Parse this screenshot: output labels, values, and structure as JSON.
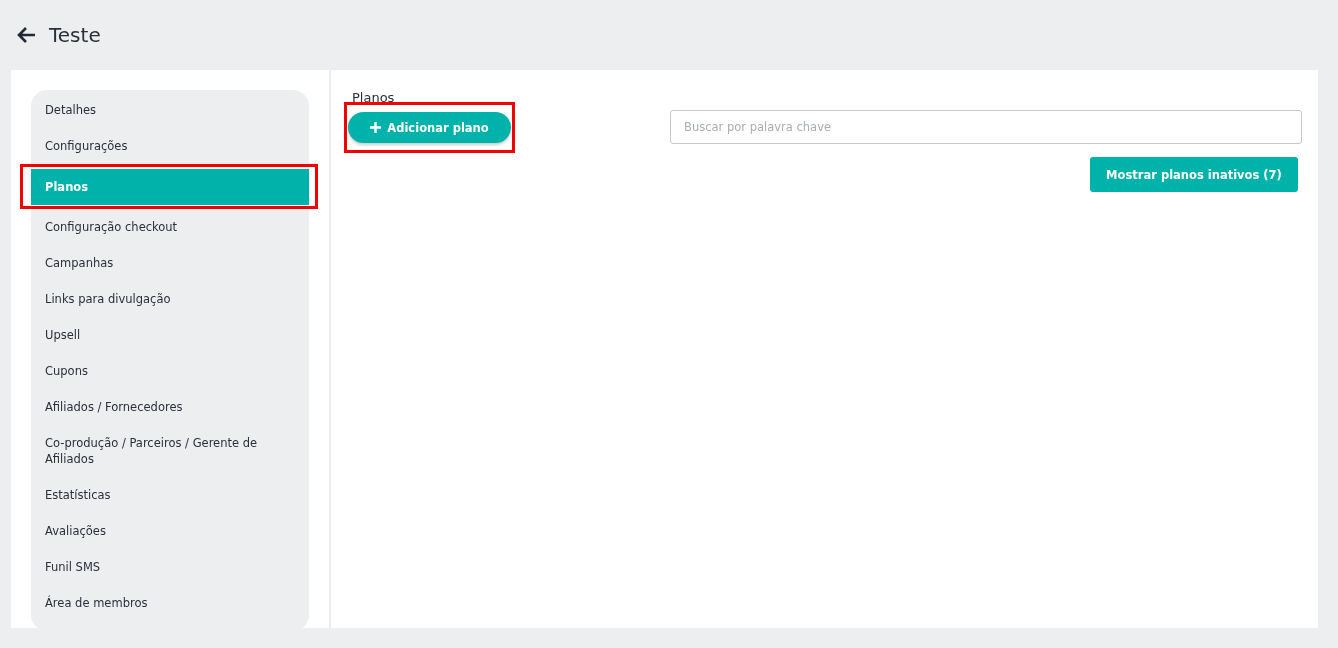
{
  "header": {
    "title": "Teste"
  },
  "sidebar": {
    "items": [
      {
        "label": "Detalhes",
        "selected": false,
        "highlighted": false
      },
      {
        "label": "Configurações",
        "selected": false,
        "highlighted": false
      },
      {
        "label": "Planos",
        "selected": true,
        "highlighted": true
      },
      {
        "label": "Configuração checkout",
        "selected": false,
        "highlighted": false
      },
      {
        "label": "Campanhas",
        "selected": false,
        "highlighted": false
      },
      {
        "label": "Links para divulgação",
        "selected": false,
        "highlighted": false
      },
      {
        "label": "Upsell",
        "selected": false,
        "highlighted": false
      },
      {
        "label": "Cupons",
        "selected": false,
        "highlighted": false
      },
      {
        "label": "Afiliados / Fornecedores",
        "selected": false,
        "highlighted": false
      },
      {
        "label": "Co-produção / Parceiros / Gerente de Afiliados",
        "selected": false,
        "highlighted": false
      },
      {
        "label": "Estatísticas",
        "selected": false,
        "highlighted": false
      },
      {
        "label": "Avaliações",
        "selected": false,
        "highlighted": false
      },
      {
        "label": "Funil SMS",
        "selected": false,
        "highlighted": false
      },
      {
        "label": "Área de membros",
        "selected": false,
        "highlighted": false
      }
    ]
  },
  "main": {
    "section_title": "Planos",
    "add_button": {
      "label": "Adicionar plano",
      "highlighted": true
    },
    "search": {
      "placeholder": "Buscar por palavra chave"
    },
    "inactive_button": {
      "label": "Mostrar planos inativos (7)"
    }
  }
}
